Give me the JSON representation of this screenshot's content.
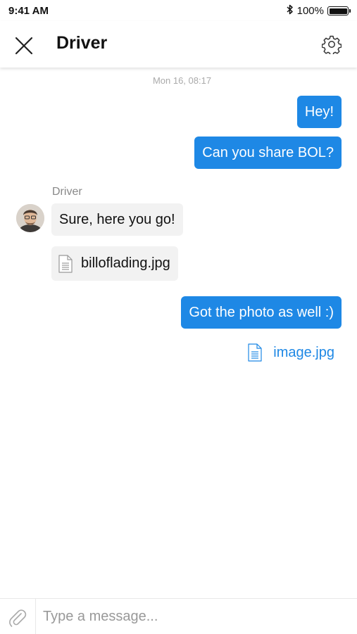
{
  "status_bar": {
    "time": "9:41 AM",
    "battery": "100%",
    "icons": [
      "bluetooth-icon",
      "battery-icon"
    ]
  },
  "header": {
    "title": "Driver",
    "icons": [
      "close-icon",
      "gear-icon"
    ]
  },
  "conversation": {
    "timestamp": "Mon 16, 08:17",
    "messages": [
      {
        "direction": "outgoing",
        "type": "text",
        "text": "Hey!"
      },
      {
        "direction": "outgoing",
        "type": "text",
        "text": "Can you share BOL?"
      },
      {
        "direction": "incoming",
        "sender": "Driver",
        "type": "text",
        "text": "Sure, here you go!"
      },
      {
        "direction": "incoming",
        "type": "file",
        "file_name": "billoflading.jpg",
        "icon": "document-icon"
      },
      {
        "direction": "outgoing",
        "type": "text",
        "text": "Got the photo as well :)"
      },
      {
        "direction": "outgoing",
        "type": "file",
        "file_name": "image.jpg",
        "icon": "document-icon"
      }
    ]
  },
  "composer": {
    "placeholder": "Type a message...",
    "value": "",
    "icons": [
      "paperclip-icon"
    ]
  },
  "colors": {
    "accent": "#1e88e5",
    "incoming_bubble": "#f2f2f2",
    "muted_text": "#888888"
  }
}
